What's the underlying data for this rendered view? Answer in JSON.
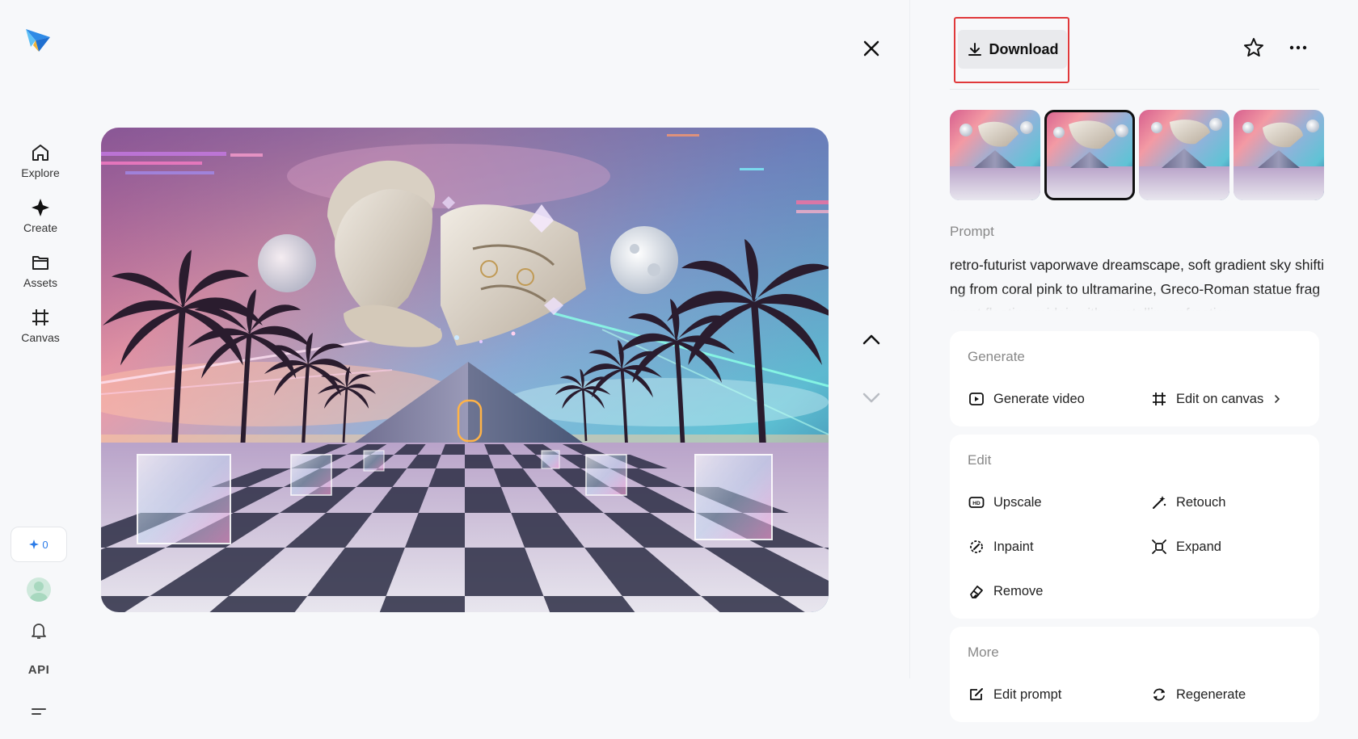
{
  "sidebar": {
    "logo_icon": "paper-plane-logo",
    "items": [
      {
        "label": "Explore",
        "icon": "home-icon"
      },
      {
        "label": "Create",
        "icon": "sparkle-diamond-icon"
      },
      {
        "label": "Assets",
        "icon": "folder-icon"
      },
      {
        "label": "Canvas",
        "icon": "canvas-crop-icon"
      }
    ],
    "credits": "0",
    "api_label": "API"
  },
  "toolbar": {
    "download_label": "Download"
  },
  "prompt": {
    "label": "Prompt",
    "text": "retro-futurist vaporwave dreamscape, soft gradient sky shifting from coral pink to ultramarine, Greco-Roman statue fragment floating midair with crystalline refraction"
  },
  "generate_card": {
    "title": "Generate",
    "actions": [
      "Generate video",
      "Edit on canvas"
    ]
  },
  "edit_card": {
    "title": "Edit",
    "actions": [
      "Upscale",
      "Retouch",
      "Inpaint",
      "Expand",
      "Remove"
    ]
  },
  "more_card": {
    "title": "More",
    "actions": [
      "Edit prompt",
      "Regenerate"
    ]
  },
  "colors": {
    "accent": "#2a7be8",
    "highlight_border": "#e0383a",
    "sky_top": "#3a4d8f",
    "sky_pink": "#f08a9e",
    "sky_cyan": "#7fd0e0"
  }
}
